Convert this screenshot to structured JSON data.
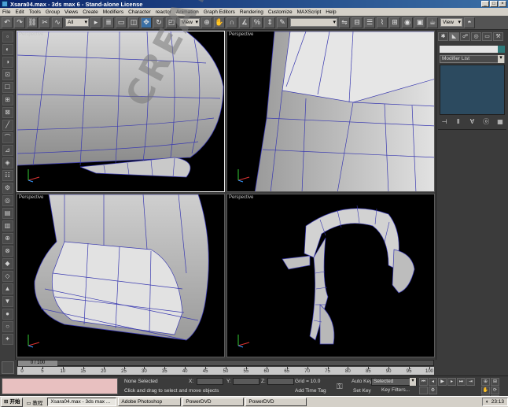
{
  "window": {
    "title": "Xsara04.max - 3ds max 6 - Stand-alone License",
    "buttons": [
      "_",
      "□",
      "×"
    ]
  },
  "menu": [
    "File",
    "Edit",
    "Tools",
    "Group",
    "Views",
    "Create",
    "Modifiers",
    "Character",
    "reactor",
    "Animation",
    "Graph Editors",
    "Rendering",
    "Customize",
    "MAXScript",
    "Help"
  ],
  "toolbar": {
    "selection_filter": "All",
    "ref_coord": "View",
    "named_sel": "",
    "view_right": "View"
  },
  "viewports": [
    {
      "label": "Perspective",
      "active": true
    },
    {
      "label": "Perspective",
      "active": false
    },
    {
      "label": "Perspective",
      "active": false
    },
    {
      "label": "Perspective",
      "active": false
    }
  ],
  "watermark": "CREATED BY SANSHI",
  "command_panel": {
    "modifier_list": "Modifier List",
    "color": "#2f7a7a"
  },
  "timeline": {
    "frame_display": "0 / 100",
    "ticks": [
      "0",
      "5",
      "10",
      "15",
      "20",
      "25",
      "30",
      "35",
      "40",
      "45",
      "50",
      "55",
      "60",
      "65",
      "70",
      "75",
      "80",
      "85",
      "90",
      "95",
      "100"
    ]
  },
  "status": {
    "selection": "None Selected",
    "prompt": "Click and drag to select and move objects",
    "x_label": "X:",
    "y_label": "Y:",
    "z_label": "Z:",
    "grid": "Grid = 10.0",
    "add_time_tag": "Add Time Tag",
    "auto_key": "Auto Key",
    "set_key": "Set Key",
    "selected": "Selected",
    "key_filters": "Key Filters..."
  },
  "taskbar": {
    "start": "开始",
    "quicklaunch": "教程",
    "tasks": [
      {
        "label": "Xsara04.max - 3ds max ...",
        "active": true
      },
      {
        "label": "Adobe Photoshop",
        "active": false
      },
      {
        "label": "PowerDVD",
        "active": false
      },
      {
        "label": "PowerDVD",
        "active": false
      }
    ],
    "clock": "23:13"
  }
}
